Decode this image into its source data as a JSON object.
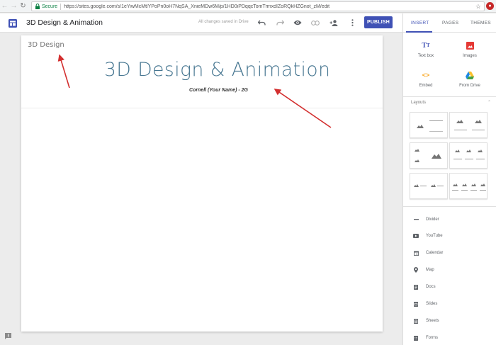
{
  "browser": {
    "secure_label": "Secure",
    "url": "https://sites.google.com/s/1eYiwMcMtlYPoPn0oH7NqSA_XnieMDw6M/p/1HD0iPDqqcTomTrmxdIZoRQkHZGnot_zM/edit"
  },
  "toolbar": {
    "site_title": "3D Design & Animation",
    "save_status": "All changes saved in Drive",
    "publish_label": "PUBLISH"
  },
  "panel": {
    "tabs": [
      {
        "label": "INSERT"
      },
      {
        "label": "PAGES"
      },
      {
        "label": "THEMES"
      }
    ],
    "insert_items": [
      {
        "label": "Text box",
        "icon": "text-box-icon"
      },
      {
        "label": "Images",
        "icon": "image-icon"
      },
      {
        "label": "Embed",
        "icon": "embed-icon"
      },
      {
        "label": "From Drive",
        "icon": "drive-icon"
      }
    ],
    "layouts_label": "Layouts",
    "components": [
      {
        "label": "Divider",
        "icon": "divider-icon"
      },
      {
        "label": "YouTube",
        "icon": "youtube-icon"
      },
      {
        "label": "Calendar",
        "icon": "calendar-icon"
      },
      {
        "label": "Map",
        "icon": "map-pin-icon"
      },
      {
        "label": "Docs",
        "icon": "docs-icon"
      },
      {
        "label": "Slides",
        "icon": "slides-icon"
      },
      {
        "label": "Sheets",
        "icon": "sheets-icon"
      },
      {
        "label": "Forms",
        "icon": "forms-icon"
      }
    ]
  },
  "page": {
    "logo_text": "3D Design",
    "title": "3D Design & Animation",
    "subtitle": "Cornell (Your Name) - 2G"
  },
  "colors": {
    "accent": "#3f51b5",
    "title": "#457590",
    "arrow": "#d32f2f"
  }
}
